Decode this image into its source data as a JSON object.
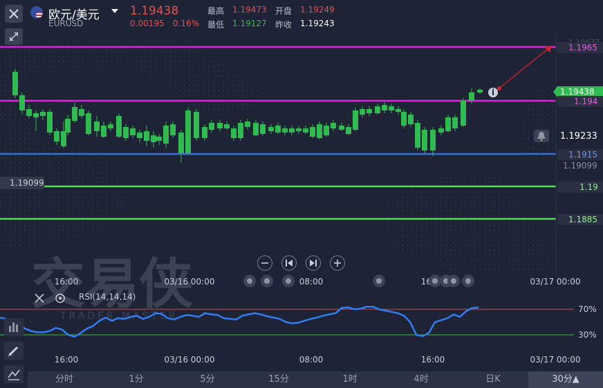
{
  "header": {
    "pair_name": "欧元/美元",
    "pair_code": "EURUSD",
    "last_price": "1.19438",
    "change_abs": "0.00195",
    "change_pct": "0.16%",
    "high_label": "最高",
    "high_value": "1.19473",
    "open_label": "开盘",
    "open_value": "1.19249",
    "low_label": "最低",
    "low_value": "1.19127",
    "prev_close_label": "昨收",
    "prev_close_value": "1.19243"
  },
  "price_levels": {
    "magenta_top": "1.1965",
    "current": "1.19438",
    "magenta_mid": "1.194",
    "alert": "1.19233",
    "blue": "1.1915",
    "low_right": "1.19099",
    "low_left": "1.19099",
    "green_1": "1.19",
    "green_2": "1.1885",
    "faded_top": "1.19673"
  },
  "time_axis": {
    "main": [
      "16:00",
      "03/16 00:00",
      "08:00",
      "16:00",
      "03/17 00:00"
    ],
    "rsi": [
      "16:00",
      "03/16 00:00",
      "08:00",
      "16:00",
      "03/17 00:00"
    ]
  },
  "rsi": {
    "label": "RSI(14,14,14)",
    "level_high": "70%",
    "level_low": "30%",
    "values": [
      57,
      55,
      52,
      47,
      40,
      36,
      34,
      34,
      36,
      41,
      38,
      30,
      27,
      33,
      40,
      44,
      52,
      57,
      52,
      56,
      55,
      58,
      60,
      55,
      58,
      64,
      63,
      56,
      54,
      58,
      61,
      60,
      58,
      64,
      62,
      61,
      56,
      55,
      54,
      60,
      62,
      64,
      62,
      59,
      57,
      55,
      50,
      48,
      49,
      52,
      55,
      57,
      60,
      62,
      64,
      72,
      73,
      70,
      71,
      74,
      74,
      70,
      68,
      66,
      64,
      60,
      50,
      30,
      28,
      33,
      50,
      53,
      56,
      62,
      58,
      67,
      72,
      73
    ]
  },
  "watermark": {
    "brand": "交易侠",
    "sub": "TRADER MASTER"
  },
  "timeframes": [
    "分时",
    "1分",
    "5分",
    "15分",
    "1时",
    "4时",
    "日K",
    "30分▲"
  ],
  "active_timeframe": "30分▲",
  "colors": {
    "up": "#ef4b4b",
    "down": "#2fbb4f",
    "magenta": "#e020e0",
    "blue": "#3b6fe0",
    "green_line": "#52e052",
    "rsi_line": "#2f7df0"
  },
  "icons": [
    "flag-eu-icon",
    "chevron-down-icon",
    "close-icon",
    "collapse-icon",
    "alert-bell-icon",
    "info-icon",
    "zoom-out-icon",
    "prev-icon",
    "next-icon",
    "zoom-in-icon",
    "settings-icon",
    "indicator-icon",
    "pencil-icon",
    "line-tool-icon"
  ]
}
